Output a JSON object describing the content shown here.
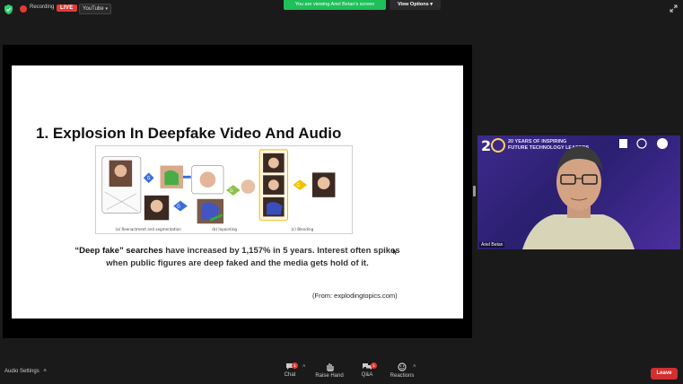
{
  "topbar": {
    "recording_label": "Recording",
    "live_label": "LIVE",
    "stream_target": "YouTube",
    "viewing_banner": "You are viewing Ariel Betan's screen",
    "view_options_label": "View Options"
  },
  "slide": {
    "title": "1. Explosion In Deepfake Video And Audio",
    "body_highlight": "“Deep fake” searches",
    "body_rest": " have increased by 1,157% in 5 years. Interest often spikes",
    "body_line2": "when public figures are deep faked and the media gets hold of it.",
    "source": "(From: explodingtopics.com)",
    "diagram_captions": [
      "(a) Reenactment and segmentation",
      "(b) Inpainting",
      "(c) Blending"
    ]
  },
  "speaker": {
    "banner_line1": "20 YEARS OF INSPIRING",
    "banner_line2": "FUTURE TECHNOLOGY LEADERS",
    "name": "Ariel Betan"
  },
  "bottombar": {
    "audio_settings_label": "Audio Settings",
    "controls": [
      {
        "label": "Chat",
        "badge": "1"
      },
      {
        "label": "Raise Hand",
        "badge": ""
      },
      {
        "label": "Q&A",
        "badge": "1"
      },
      {
        "label": "Reactions",
        "badge": ""
      }
    ],
    "leave_label": "Leave"
  },
  "colors": {
    "live": "#e53935",
    "viewing_banner": "#1fbf59",
    "leave": "#d32f2f",
    "speaker_bg": "#3e2a8c"
  }
}
